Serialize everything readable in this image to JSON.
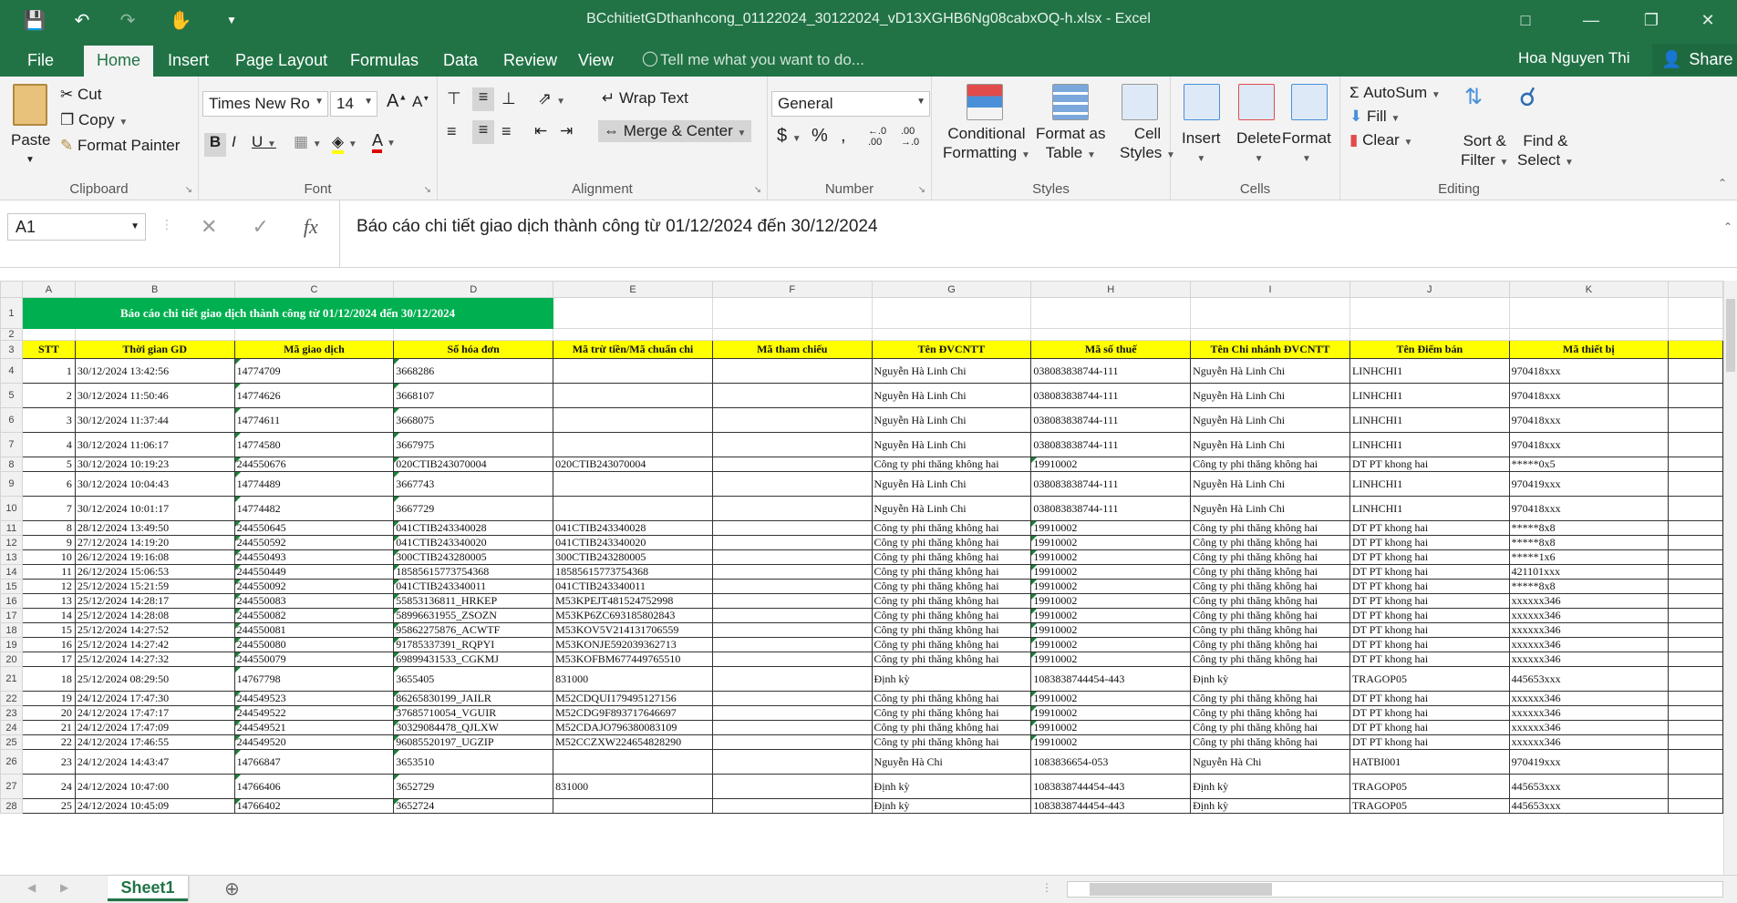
{
  "window": {
    "title": "BCchitietGDthanhcong_01122024_30122024_vD13XGHB6Ng08cabxOQ-h.xlsx - Excel",
    "user": "Hoa Nguyen Thi",
    "share": "Share"
  },
  "tabs": [
    "File",
    "Home",
    "Insert",
    "Page Layout",
    "Formulas",
    "Data",
    "Review",
    "View"
  ],
  "tell_me": "Tell me what you want to do...",
  "ribbon": {
    "clipboard": {
      "paste": "Paste",
      "cut": "Cut",
      "copy": "Copy",
      "format_painter": "Format Painter",
      "label": "Clipboard"
    },
    "font": {
      "name": "Times New Ro",
      "size": "14",
      "label": "Font"
    },
    "alignment": {
      "wrap": "Wrap Text",
      "merge": "Merge & Center",
      "label": "Alignment"
    },
    "number": {
      "format": "General",
      "label": "Number"
    },
    "styles": {
      "conditional": "Conditional",
      "conditional2": "Formatting",
      "format_table": "Format as",
      "format_table2": "Table",
      "cell_styles": "Cell",
      "cell_styles2": "Styles",
      "label": "Styles"
    },
    "cells": {
      "insert": "Insert",
      "delete": "Delete",
      "format": "Format",
      "label": "Cells"
    },
    "editing": {
      "autosum": "AutoSum",
      "fill": "Fill",
      "clear": "Clear",
      "sort": "Sort &",
      "sort2": "Filter",
      "find": "Find &",
      "find2": "Select",
      "label": "Editing"
    }
  },
  "formula_bar": {
    "name_box": "A1",
    "fx": "fx",
    "content": "Báo cáo chi tiết giao dịch thành công từ 01/12/2024 đến 30/12/2024"
  },
  "sheet": {
    "columns": [
      "A",
      "B",
      "C",
      "D",
      "E",
      "F",
      "G",
      "H",
      "I",
      "J",
      "K"
    ],
    "title": "Báo cáo chi tiết giao dịch thành công từ 01/12/2024 đến 30/12/2024",
    "headers": [
      "STT",
      "Thời gian GD",
      "Mã giao dịch",
      "Số hóa đơn",
      "Mã trừ tiền/Mã chuẩn chi",
      "Mã tham chiếu",
      "Tên ĐVCNTT",
      "Mã số thuế",
      "Tên Chi nhánh ĐVCNTT",
      "Tên Điểm bán",
      "Mã thiết bị"
    ],
    "rows": [
      {
        "r": "4",
        "tall": true,
        "c": [
          "1",
          "30/12/2024 13:42:56",
          "14774709",
          "3668286",
          "",
          "",
          "Nguyễn Hà Linh Chi",
          "038083838744-111",
          "Nguyễn Hà Linh Chi",
          "LINHCHI1",
          "970418xxx"
        ]
      },
      {
        "r": "5",
        "tall": true,
        "c": [
          "2",
          "30/12/2024 11:50:46",
          "14774626",
          "3668107",
          "",
          "",
          "Nguyễn Hà Linh Chi",
          "038083838744-111",
          "Nguyễn Hà Linh Chi",
          "LINHCHI1",
          "970418xxx"
        ]
      },
      {
        "r": "6",
        "tall": true,
        "c": [
          "3",
          "30/12/2024 11:37:44",
          "14774611",
          "3668075",
          "",
          "",
          "Nguyễn Hà Linh Chi",
          "038083838744-111",
          "Nguyễn Hà Linh Chi",
          "LINHCHI1",
          "970418xxx"
        ]
      },
      {
        "r": "7",
        "tall": true,
        "c": [
          "4",
          "30/12/2024 11:06:17",
          "14774580",
          "3667975",
          "",
          "",
          "Nguyễn Hà Linh Chi",
          "038083838744-111",
          "Nguyễn Hà Linh Chi",
          "LINHCHI1",
          "970418xxx"
        ]
      },
      {
        "r": "8",
        "tall": false,
        "c": [
          "5",
          "30/12/2024 10:19:23",
          "244550676",
          "020CTIB243070004",
          "020CTIB243070004",
          "",
          "Công ty phi thăng không hai",
          "19910002",
          "Công ty phi thăng không hai",
          "DT PT khong hai",
          "*****0x5"
        ]
      },
      {
        "r": "9",
        "tall": true,
        "c": [
          "6",
          "30/12/2024 10:04:43",
          "14774489",
          "3667743",
          "",
          "",
          "Nguyễn Hà Linh Chi",
          "038083838744-111",
          "Nguyễn Hà Linh Chi",
          "LINHCHI1",
          "970419xxx"
        ]
      },
      {
        "r": "10",
        "tall": true,
        "c": [
          "7",
          "30/12/2024 10:01:17",
          "14774482",
          "3667729",
          "",
          "",
          "Nguyễn Hà Linh Chi",
          "038083838744-111",
          "Nguyễn Hà Linh Chi",
          "LINHCHI1",
          "970418xxx"
        ]
      },
      {
        "r": "11",
        "tall": false,
        "c": [
          "8",
          "28/12/2024 13:49:50",
          "244550645",
          "041CTIB243340028",
          "041CTIB243340028",
          "",
          "Công ty phi thăng không hai",
          "19910002",
          "Công ty phi thăng không hai",
          "DT PT khong hai",
          "*****8x8"
        ]
      },
      {
        "r": "12",
        "tall": false,
        "c": [
          "9",
          "27/12/2024 14:19:20",
          "244550592",
          "041CTIB243340020",
          "041CTIB243340020",
          "",
          "Công ty phi thăng không hai",
          "19910002",
          "Công ty phi thăng không hai",
          "DT PT khong hai",
          "*****8x8"
        ]
      },
      {
        "r": "13",
        "tall": false,
        "c": [
          "10",
          "26/12/2024 19:16:08",
          "244550493",
          "300CTIB243280005",
          "300CTIB243280005",
          "",
          "Công ty phi thăng không hai",
          "19910002",
          "Công ty phi thăng không hai",
          "DT PT khong hai",
          "*****1x6"
        ]
      },
      {
        "r": "14",
        "tall": false,
        "c": [
          "11",
          "26/12/2024 15:06:53",
          "244550449",
          "18585615773754368",
          "18585615773754368",
          "",
          "Công ty phi thăng không hai",
          "19910002",
          "Công ty phi thăng không hai",
          "DT PT khong hai",
          "421101xxx"
        ]
      },
      {
        "r": "15",
        "tall": false,
        "c": [
          "12",
          "25/12/2024 15:21:59",
          "244550092",
          "041CTIB243340011",
          "041CTIB243340011",
          "",
          "Công ty phi thăng không hai",
          "19910002",
          "Công ty phi thăng không hai",
          "DT PT khong hai",
          "*****8x8"
        ]
      },
      {
        "r": "16",
        "tall": false,
        "c": [
          "13",
          "25/12/2024 14:28:17",
          "244550083",
          "55853136811_HRKEP",
          "M53KPEJT481524752998",
          "",
          "Công ty phi thăng không hai",
          "19910002",
          "Công ty phi thăng không hai",
          "DT PT khong hai",
          "xxxxxx346"
        ]
      },
      {
        "r": "17",
        "tall": false,
        "c": [
          "14",
          "25/12/2024 14:28:08",
          "244550082",
          "58996631955_ZSOZN",
          "M53KP6ZC693185802843",
          "",
          "Công ty phi thăng không hai",
          "19910002",
          "Công ty phi thăng không hai",
          "DT PT khong hai",
          "xxxxxx346"
        ]
      },
      {
        "r": "18",
        "tall": false,
        "c": [
          "15",
          "25/12/2024 14:27:52",
          "244550081",
          "95862275876_ACWTF",
          "M53KOV5V214131706559",
          "",
          "Công ty phi thăng không hai",
          "19910002",
          "Công ty phi thăng không hai",
          "DT PT khong hai",
          "xxxxxx346"
        ]
      },
      {
        "r": "19",
        "tall": false,
        "c": [
          "16",
          "25/12/2024 14:27:42",
          "244550080",
          "91785337391_RQPYI",
          "M53KONJE592039362713",
          "",
          "Công ty phi thăng không hai",
          "19910002",
          "Công ty phi thăng không hai",
          "DT PT khong hai",
          "xxxxxx346"
        ]
      },
      {
        "r": "20",
        "tall": false,
        "c": [
          "17",
          "25/12/2024 14:27:32",
          "244550079",
          "69899431533_CGKMJ",
          "M53KOFBM677449765510",
          "",
          "Công ty phi thăng không hai",
          "19910002",
          "Công ty phi thăng không hai",
          "DT PT khong hai",
          "xxxxxx346"
        ]
      },
      {
        "r": "21",
        "tall": true,
        "c": [
          "18",
          "25/12/2024 08:29:50",
          "14767798",
          "3655405",
          "831000",
          "",
          "Định kỳ",
          "1083838744454-443",
          "Định kỳ",
          "TRAGOP05",
          "445653xxx"
        ]
      },
      {
        "r": "22",
        "tall": false,
        "c": [
          "19",
          "24/12/2024 17:47:30",
          "244549523",
          "86265830199_JAILR",
          "M52CDQUI179495127156",
          "",
          "Công ty phi thăng không hai",
          "19910002",
          "Công ty phi thăng không hai",
          "DT PT khong hai",
          "xxxxxx346"
        ]
      },
      {
        "r": "23",
        "tall": false,
        "c": [
          "20",
          "24/12/2024 17:47:17",
          "244549522",
          "37685710054_VGUIR",
          "M52CDG9F893717646697",
          "",
          "Công ty phi thăng không hai",
          "19910002",
          "Công ty phi thăng không hai",
          "DT PT khong hai",
          "xxxxxx346"
        ]
      },
      {
        "r": "24",
        "tall": false,
        "c": [
          "21",
          "24/12/2024 17:47:09",
          "244549521",
          "30329084478_QJLXW",
          "M52CDAJO796380083109",
          "",
          "Công ty phi thăng không hai",
          "19910002",
          "Công ty phi thăng không hai",
          "DT PT khong hai",
          "xxxxxx346"
        ]
      },
      {
        "r": "25",
        "tall": false,
        "c": [
          "22",
          "24/12/2024 17:46:55",
          "244549520",
          "96085520197_UGZIP",
          "M52CCZXW224654828290",
          "",
          "Công ty phi thăng không hai",
          "19910002",
          "Công ty phi thăng không hai",
          "DT PT khong hai",
          "xxxxxx346"
        ]
      },
      {
        "r": "26",
        "tall": true,
        "c": [
          "23",
          "24/12/2024 14:43:47",
          "14766847",
          "3653510",
          "",
          "",
          "Nguyễn Hà Chi",
          "1083836654-053",
          "Nguyễn Hà Chi",
          "HATBI001",
          "970419xxx"
        ]
      },
      {
        "r": "27",
        "tall": true,
        "c": [
          "24",
          "24/12/2024 10:47:00",
          "14766406",
          "3652729",
          "831000",
          "",
          "Định kỳ",
          "1083838744454-443",
          "Định kỳ",
          "TRAGOP05",
          "445653xxx"
        ]
      },
      {
        "r": "28",
        "tall": false,
        "c": [
          "25",
          "24/12/2024 10:45:09",
          "14766402",
          "3652724",
          "",
          "",
          "Định kỳ",
          "1083838744454-443",
          "Định kỳ",
          "TRAGOP05",
          "445653xxx"
        ]
      }
    ]
  },
  "sheet_tab": "Sheet1",
  "colors": {
    "excel_green": "#217346",
    "title_fill": "#00b050",
    "header_fill": "#ffff00"
  }
}
